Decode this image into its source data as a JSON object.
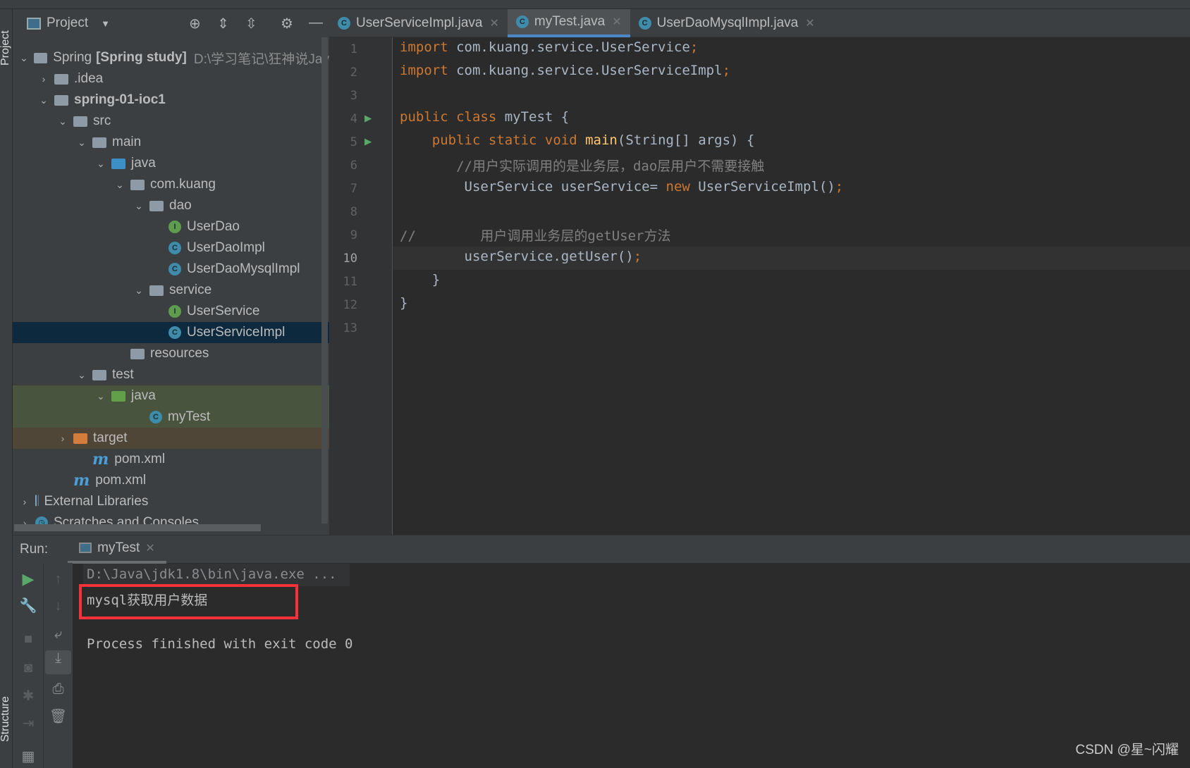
{
  "side_tabs": {
    "project": "Project",
    "structure": "Structure"
  },
  "project_panel": {
    "title": "Project",
    "tree": [
      {
        "label": "Spring",
        "bold": "[Spring study]",
        "path": "D:\\学习笔记\\狂神说Jav",
        "depth": 0,
        "arrow": "down",
        "icon": "module-folder"
      },
      {
        "label": ".idea",
        "depth": 1,
        "arrow": "right",
        "icon": "folder"
      },
      {
        "label": "spring-01-ioc1",
        "depth": 1,
        "arrow": "down",
        "icon": "module-folder",
        "bold_all": true
      },
      {
        "label": "src",
        "depth": 2,
        "arrow": "down",
        "icon": "folder"
      },
      {
        "label": "main",
        "depth": 3,
        "arrow": "down",
        "icon": "folder"
      },
      {
        "label": "java",
        "depth": 4,
        "arrow": "down",
        "icon": "source-folder"
      },
      {
        "label": "com.kuang",
        "depth": 5,
        "arrow": "down",
        "icon": "package"
      },
      {
        "label": "dao",
        "depth": 6,
        "arrow": "down",
        "icon": "package"
      },
      {
        "label": "UserDao",
        "depth": 7,
        "icon": "interface"
      },
      {
        "label": "UserDaoImpl",
        "depth": 7,
        "icon": "class"
      },
      {
        "label": "UserDaoMysqlImpl",
        "depth": 7,
        "icon": "class"
      },
      {
        "label": "service",
        "depth": 6,
        "arrow": "down",
        "icon": "package"
      },
      {
        "label": "UserService",
        "depth": 7,
        "icon": "interface"
      },
      {
        "label": "UserServiceImpl",
        "depth": 7,
        "icon": "class",
        "selected": true
      },
      {
        "label": "resources",
        "depth": 5,
        "icon": "resources-folder"
      },
      {
        "label": "test",
        "depth": 3,
        "arrow": "down",
        "icon": "folder"
      },
      {
        "label": "java",
        "depth": 4,
        "arrow": "down",
        "icon": "test-folder",
        "test": true
      },
      {
        "label": "myTest",
        "depth": 6,
        "icon": "class",
        "test": true
      },
      {
        "label": "target",
        "depth": 2,
        "arrow": "right",
        "icon": "excluded-folder",
        "target": true
      },
      {
        "label": "pom.xml",
        "depth": 3,
        "icon": "maven"
      },
      {
        "label": "pom.xml",
        "depth": 2,
        "icon": "maven"
      },
      {
        "label": "External Libraries",
        "depth": 0,
        "arrow": "right",
        "icon": "libraries"
      },
      {
        "label": "Scratches and Consoles",
        "depth": 0,
        "arrow": "right",
        "icon": "scratches"
      }
    ]
  },
  "editor": {
    "tabs": [
      {
        "label": "UserServiceImpl.java",
        "active": false
      },
      {
        "label": "myTest.java",
        "active": true
      },
      {
        "label": "UserDaoMysqlImpl.java",
        "active": false
      }
    ],
    "current_line": 10,
    "lines": [
      {
        "n": "1",
        "parts": [
          [
            "kw",
            "import "
          ],
          [
            "t",
            "com.kuang.service.UserService"
          ],
          [
            "kw",
            ";"
          ]
        ]
      },
      {
        "n": "2",
        "parts": [
          [
            "kw",
            "import "
          ],
          [
            "t",
            "com.kuang.service.UserServiceImpl"
          ],
          [
            "kw",
            ";"
          ]
        ]
      },
      {
        "n": "3",
        "parts": []
      },
      {
        "n": "4",
        "run": true,
        "parts": [
          [
            "kw",
            "public class "
          ],
          [
            "t",
            "myTest {"
          ]
        ]
      },
      {
        "n": "5",
        "run": true,
        "parts": [
          [
            "t",
            "    "
          ],
          [
            "kw",
            "public static void "
          ],
          [
            "fn",
            "main"
          ],
          [
            "t",
            "(String[] args) {"
          ]
        ]
      },
      {
        "n": "6",
        "parts": [
          [
            "cm",
            "       //用户实际调用的是业务层，dao层用户不需要接触"
          ]
        ]
      },
      {
        "n": "7",
        "parts": [
          [
            "t",
            "        UserService userService= "
          ],
          [
            "kw",
            "new "
          ],
          [
            "t",
            "UserServiceImpl()"
          ],
          [
            "kw",
            ";"
          ]
        ]
      },
      {
        "n": "8",
        "parts": []
      },
      {
        "n": "9",
        "parts": [
          [
            "cm",
            "//        用户调用业务层的getUser方法"
          ]
        ]
      },
      {
        "n": "10",
        "parts": [
          [
            "t",
            "        userService.getUser()"
          ],
          [
            "kw",
            ";"
          ]
        ]
      },
      {
        "n": "11",
        "parts": [
          [
            "t",
            "    }"
          ]
        ]
      },
      {
        "n": "12",
        "parts": [
          [
            "t",
            "}"
          ]
        ]
      },
      {
        "n": "13",
        "parts": []
      }
    ]
  },
  "run": {
    "label": "Run:",
    "tab": "myTest",
    "console": [
      "D:\\Java\\jdk1.8\\bin\\java.exe ...",
      "mysql获取用户数据",
      "",
      "Process finished with exit code 0"
    ]
  },
  "watermark": "CSDN @星~闪耀",
  "colors": {
    "keyword": "#CC7832",
    "text": "#A9B7C6",
    "comment": "#808080",
    "method": "#FFC66D",
    "highlight_box": "#F5313A",
    "selection": "#0D293E"
  }
}
